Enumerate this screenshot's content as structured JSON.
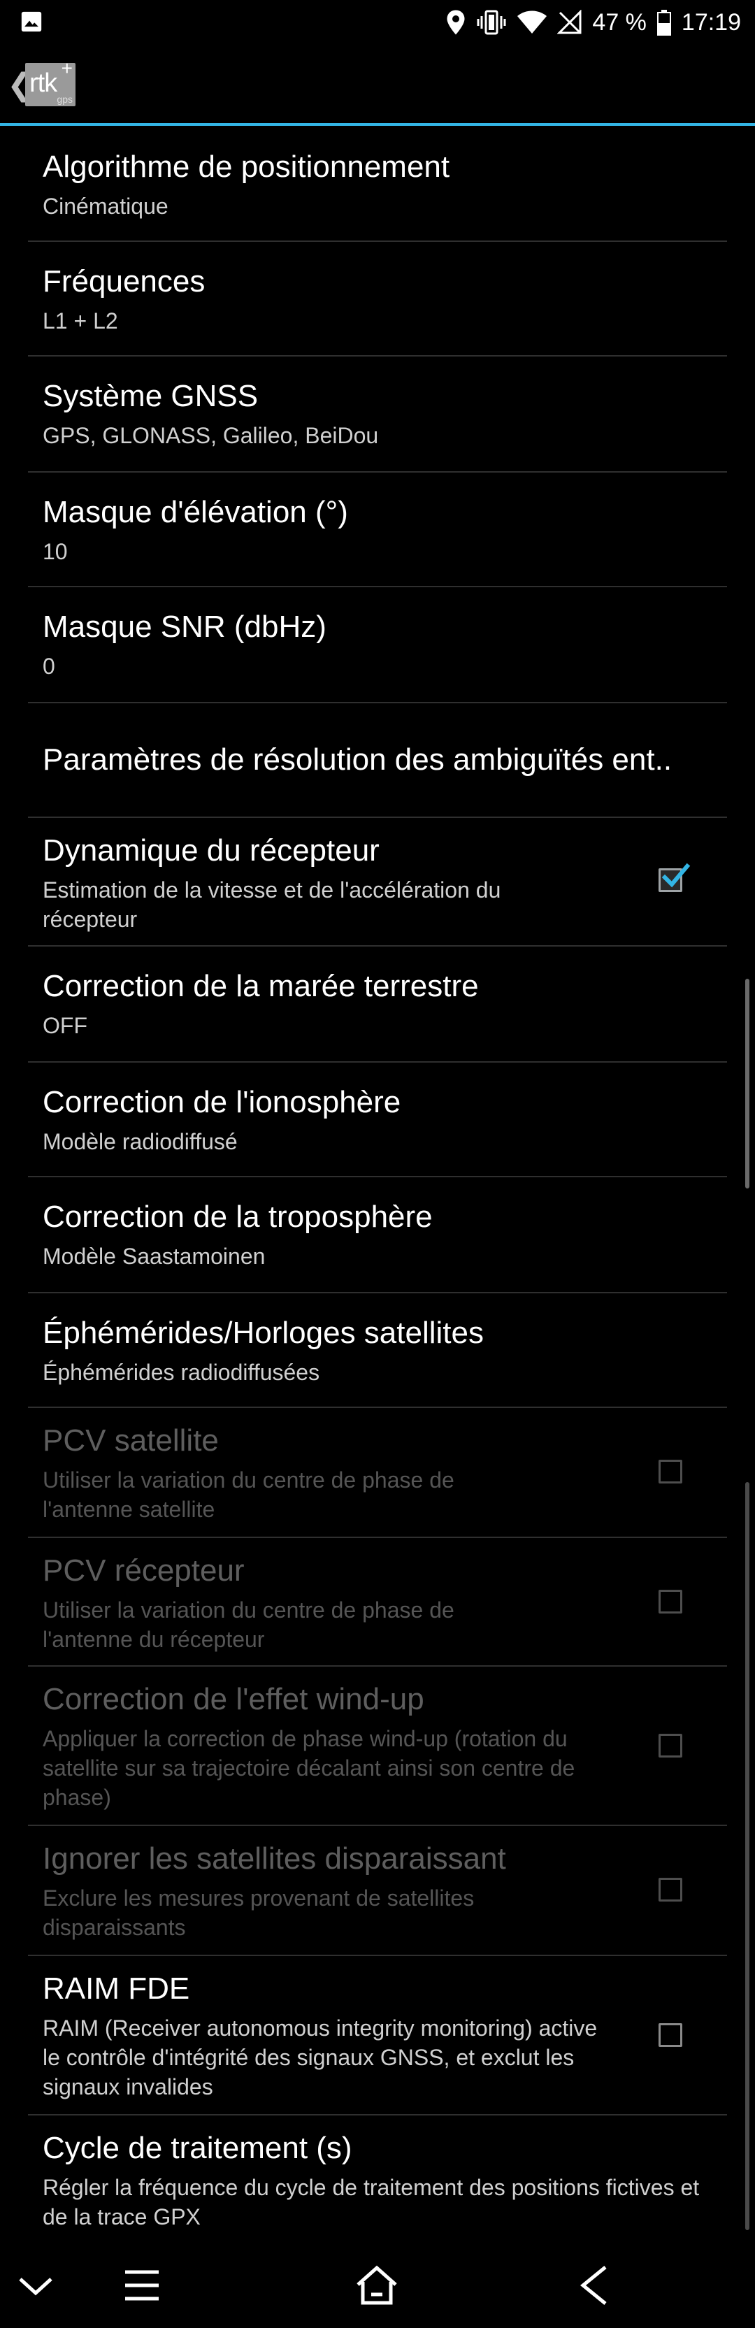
{
  "status_bar": {
    "battery": "47 %",
    "time": "17:19"
  },
  "app": {
    "logo_text": "rtk",
    "logo_plus": "+",
    "logo_sub": "gps"
  },
  "settings": [
    {
      "title": "Algorithme de positionnement",
      "subtitle": "Cinématique",
      "checkbox": null,
      "enabled": true
    },
    {
      "title": "Fréquences",
      "subtitle": "L1 + L2",
      "checkbox": null,
      "enabled": true
    },
    {
      "title": "Système GNSS",
      "subtitle": "GPS, GLONASS, Galileo, BeiDou",
      "checkbox": null,
      "enabled": true
    },
    {
      "title": "Masque d'élévation (°)",
      "subtitle": "10",
      "checkbox": null,
      "enabled": true
    },
    {
      "title": "Masque SNR (dbHz)",
      "subtitle": "0",
      "checkbox": null,
      "enabled": true
    },
    {
      "title": "Paramètres de résolution des ambiguïtés ent..",
      "subtitle": "",
      "checkbox": null,
      "enabled": true
    },
    {
      "title": "Dynamique du récepteur",
      "subtitle": "Estimation de la vitesse et de l'accélération du récepteur",
      "checkbox": true,
      "enabled": true
    },
    {
      "title": "Correction de la marée terrestre",
      "subtitle": "OFF",
      "checkbox": null,
      "enabled": true
    },
    {
      "title": "Correction de l'ionosphère",
      "subtitle": "Modèle radiodiffusé",
      "checkbox": null,
      "enabled": true
    },
    {
      "title": "Correction de la troposphère",
      "subtitle": "Modèle Saastamoinen",
      "checkbox": null,
      "enabled": true
    },
    {
      "title": "Éphémérides/Horloges satellites",
      "subtitle": "Éphémérides radiodiffusées",
      "checkbox": null,
      "enabled": true
    },
    {
      "title": "PCV satellite",
      "subtitle": "Utiliser la variation du centre de phase de l'antenne satellite",
      "checkbox": false,
      "enabled": false
    },
    {
      "title": "PCV récepteur",
      "subtitle": "Utiliser la variation du centre de phase de l'antenne du récepteur",
      "checkbox": false,
      "enabled": false
    },
    {
      "title": "Correction de l'effet wind-up",
      "subtitle": "Appliquer la correction de phase wind-up (rotation du satellite sur sa trajectoire décalant ainsi son centre de phase)",
      "checkbox": false,
      "enabled": false
    },
    {
      "title": "Ignorer les satellites disparaissant",
      "subtitle": "Exclure les mesures provenant de satellites disparaissants",
      "checkbox": false,
      "enabled": false
    },
    {
      "title": "RAIM FDE",
      "subtitle": "RAIM (Receiver autonomous integrity monitoring) active le contrôle d'intégrité des signaux GNSS, et exclut les signaux invalides",
      "checkbox": false,
      "enabled": true
    },
    {
      "title": "Cycle de traitement (s)",
      "subtitle": "Régler la fréquence du cycle de traitement des positions fictives et de la trace GPX",
      "checkbox": null,
      "enabled": true
    }
  ],
  "colors": {
    "accent": "#33b5e5",
    "divider": "#2f2f2f",
    "disabled_text": "#5e5e5e"
  },
  "icons": {
    "status_left": "image-icon",
    "status_right": [
      "location-icon",
      "vibrate-icon",
      "wifi-icon",
      "no-sim-icon",
      "battery-icon"
    ],
    "nav": [
      "chevron-down-icon",
      "menu-icon",
      "home-icon",
      "back-icon"
    ]
  }
}
